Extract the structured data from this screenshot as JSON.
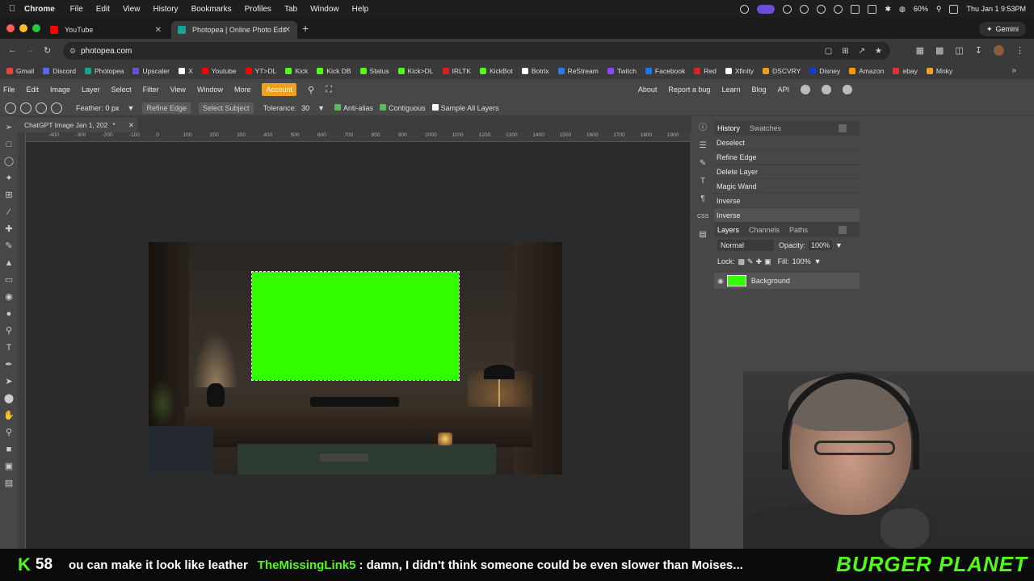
{
  "macos": {
    "app_name": "Chrome",
    "menus": [
      "File",
      "Edit",
      "View",
      "History",
      "Bookmarks",
      "Profiles",
      "Tab",
      "Window",
      "Help"
    ],
    "battery": "60%",
    "datetime": "Thu Jan 1  9:53PM"
  },
  "browser": {
    "tabs": [
      {
        "title": "YouTube",
        "color": "#ff0000"
      },
      {
        "title": "Photopea | Online Photo Edit",
        "color": "#18a497"
      }
    ],
    "gemini_label": "Gemini",
    "url": "photopea.com",
    "bookmarks": [
      {
        "label": "Gmail",
        "color": "#ea4335"
      },
      {
        "label": "Discord",
        "color": "#5865f2"
      },
      {
        "label": "Photopea",
        "color": "#18a497"
      },
      {
        "label": "Upscaler",
        "color": "#6b4fd8"
      },
      {
        "label": "X",
        "color": "#ffffff"
      },
      {
        "label": "Youtube",
        "color": "#ff0000"
      },
      {
        "label": "YT>DL",
        "color": "#ff0000"
      },
      {
        "label": "Kick",
        "color": "#53fc18"
      },
      {
        "label": "Kick DB",
        "color": "#53fc18"
      },
      {
        "label": "Status",
        "color": "#53fc18"
      },
      {
        "label": "Kick>DL",
        "color": "#53fc18"
      },
      {
        "label": "IRLTK",
        "color": "#e02020"
      },
      {
        "label": "KickBot",
        "color": "#53fc18"
      },
      {
        "label": "Botrix",
        "color": "#ffffff"
      },
      {
        "label": "ReStream",
        "color": "#2c7be5"
      },
      {
        "label": "Twitch",
        "color": "#9146ff"
      },
      {
        "label": "Facebook",
        "color": "#1877f2"
      },
      {
        "label": "Red",
        "color": "#e02020"
      },
      {
        "label": "Xfinity",
        "color": "#ffffff"
      },
      {
        "label": "DSCVRY",
        "color": "#f0a020"
      },
      {
        "label": "Disney",
        "color": "#113ccf"
      },
      {
        "label": "Amazon",
        "color": "#ff9900"
      },
      {
        "label": "ebay",
        "color": "#e53238"
      },
      {
        "label": "Mnky",
        "color": "#f0a020"
      }
    ]
  },
  "photopea": {
    "menu": [
      "File",
      "Edit",
      "Image",
      "Layer",
      "Select",
      "Filter",
      "View",
      "Window",
      "More"
    ],
    "account_label": "Account",
    "right_links": [
      "About",
      "Report a bug",
      "Learn",
      "Blog",
      "API"
    ],
    "options": {
      "feather_label": "Feather:",
      "feather_value": "0 px",
      "refine_edge": "Refine Edge",
      "select_subject": "Select Subject",
      "tolerance_label": "Tolerance:",
      "tolerance_value": "30",
      "anti_alias": "Anti-alias",
      "contiguous": "Contiguous",
      "sample_all": "Sample All Layers"
    },
    "doc_tab": "ChatGPT Image Jan 1, 202",
    "ruler_ticks": [
      "-400",
      "-300",
      "-200",
      "-100",
      "0",
      "100",
      "200",
      "300",
      "400",
      "500",
      "600",
      "700",
      "800",
      "900",
      "1000",
      "1100",
      "1200",
      "1300",
      "1400",
      "1500",
      "1600",
      "1700",
      "1800",
      "1900"
    ],
    "history_tabs": [
      "History",
      "Swatches"
    ],
    "history": [
      "Deselect",
      "Refine Edge",
      "Delete Layer",
      "Magic Wand",
      "Inverse",
      "Inverse"
    ],
    "layers_tabs": [
      "Layers",
      "Channels",
      "Paths"
    ],
    "blend_mode": "Normal",
    "opacity_label": "Opacity:",
    "opacity_value": "100%",
    "lock_label": "Lock:",
    "fill_label": "Fill:",
    "fill_value": "100%",
    "layer_name": "Background"
  },
  "stream": {
    "count": "58",
    "msg1": "ou can make it look like leather",
    "user": "TheMissingLink5",
    "msg2": ": damn, I didn't think someone could be even slower than Moises...",
    "brand": "BURGER PLANET"
  }
}
